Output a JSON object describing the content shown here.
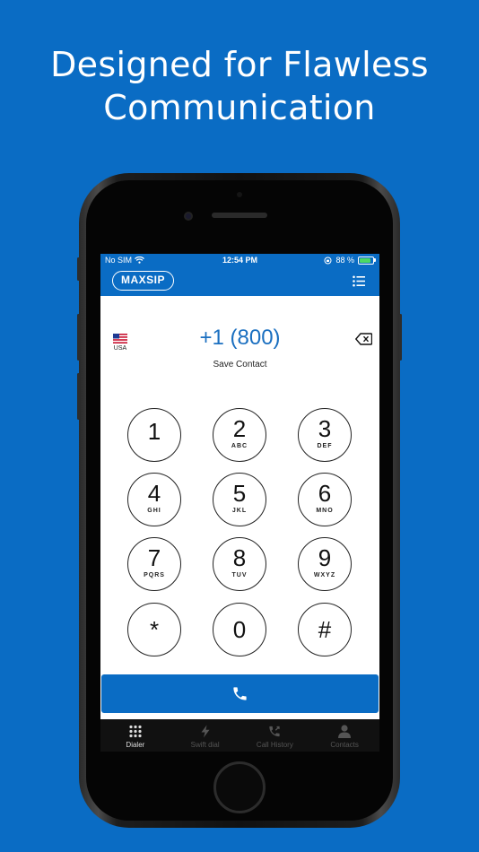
{
  "headline": {
    "line1": "Designed for Flawless",
    "line2": "Communication"
  },
  "status_bar": {
    "carrier": "No SIM",
    "time": "12:54 PM",
    "battery_percent": "88 %",
    "battery_level": 0.88
  },
  "app_bar": {
    "logo": "MAXSIP",
    "menu_icon": "list-menu-icon"
  },
  "dialer": {
    "country": "USA",
    "flag_icon": "us-flag-icon",
    "number": "+1 (800)",
    "save_contact": "Save Contact",
    "backspace_icon": "backspace-icon"
  },
  "keypad": [
    {
      "digit": "1",
      "letters": ""
    },
    {
      "digit": "2",
      "letters": "ABC"
    },
    {
      "digit": "3",
      "letters": "DEF"
    },
    {
      "digit": "4",
      "letters": "GHI"
    },
    {
      "digit": "5",
      "letters": "JKL"
    },
    {
      "digit": "6",
      "letters": "MNO"
    },
    {
      "digit": "7",
      "letters": "PQRS"
    },
    {
      "digit": "8",
      "letters": "TUV"
    },
    {
      "digit": "9",
      "letters": "WXYZ"
    },
    {
      "digit": "*",
      "letters": ""
    },
    {
      "digit": "0",
      "letters": ""
    },
    {
      "digit": "#",
      "letters": ""
    }
  ],
  "call_button": {
    "icon": "phone-icon"
  },
  "tabs": [
    {
      "label": "Dialer",
      "icon": "keypad-grid-icon",
      "active": true
    },
    {
      "label": "Swift dial",
      "icon": "lightning-icon",
      "active": false
    },
    {
      "label": "Call History",
      "icon": "call-history-icon",
      "active": false
    },
    {
      "label": "Contacts",
      "icon": "person-icon",
      "active": false
    }
  ],
  "colors": {
    "brand_blue": "#0a6cc4",
    "number_blue": "#1a6fc0",
    "tabbar_bg": "#111111"
  }
}
